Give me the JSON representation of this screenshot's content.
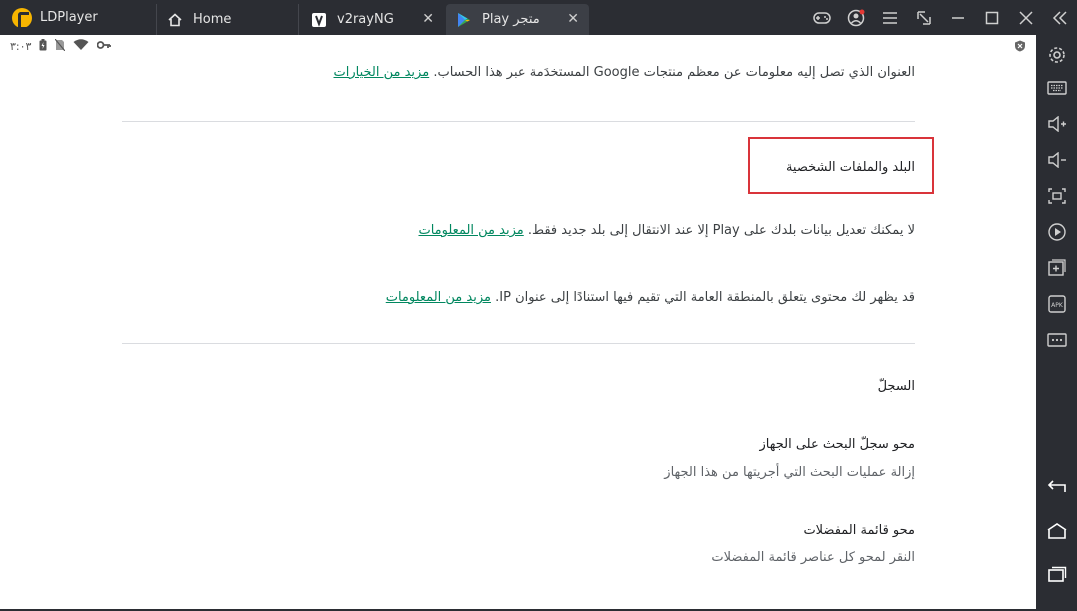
{
  "titlebar": {
    "app_name": "LDPlayer",
    "tabs": [
      {
        "label": "Home"
      },
      {
        "label": "v2rayNG"
      },
      {
        "label": "Play متجر"
      }
    ]
  },
  "statusbar": {
    "time": "٣:٠٣"
  },
  "content": {
    "address_text": "العنوان الذي تصل إليه معلومات عن معظم منتجات Google المستخدَمة عبر هذا الحساب.",
    "address_link": "مزيد من الخيارات",
    "country_heading": "البلد والملفات الشخصية",
    "country_text": "لا يمكنك تعديل بيانات بلدك على Play إلا عند الانتقال إلى بلد جديد فقط.",
    "country_link": "مزيد من المعلومات",
    "ip_text": "قد يظهر لك محتوى يتعلق بالمنطقة العامة التي تقيم فيها استنادًا إلى عنوان IP.",
    "ip_link": "مزيد من المعلومات",
    "history_heading": "السجلّ",
    "clear_search_title": "محو سجلّ البحث على الجهاز",
    "clear_search_sub": "إزالة عمليات البحث التي أجريتها من هذا الجهاز",
    "clear_favorites_title": "محو قائمة المفضلات",
    "clear_favorites_sub": "النقر لمحو كل عناصر قائمة المفضلات"
  },
  "colors": {
    "accent": "#01875f",
    "highlight": "#d9343a",
    "chrome": "#2b2d33"
  }
}
